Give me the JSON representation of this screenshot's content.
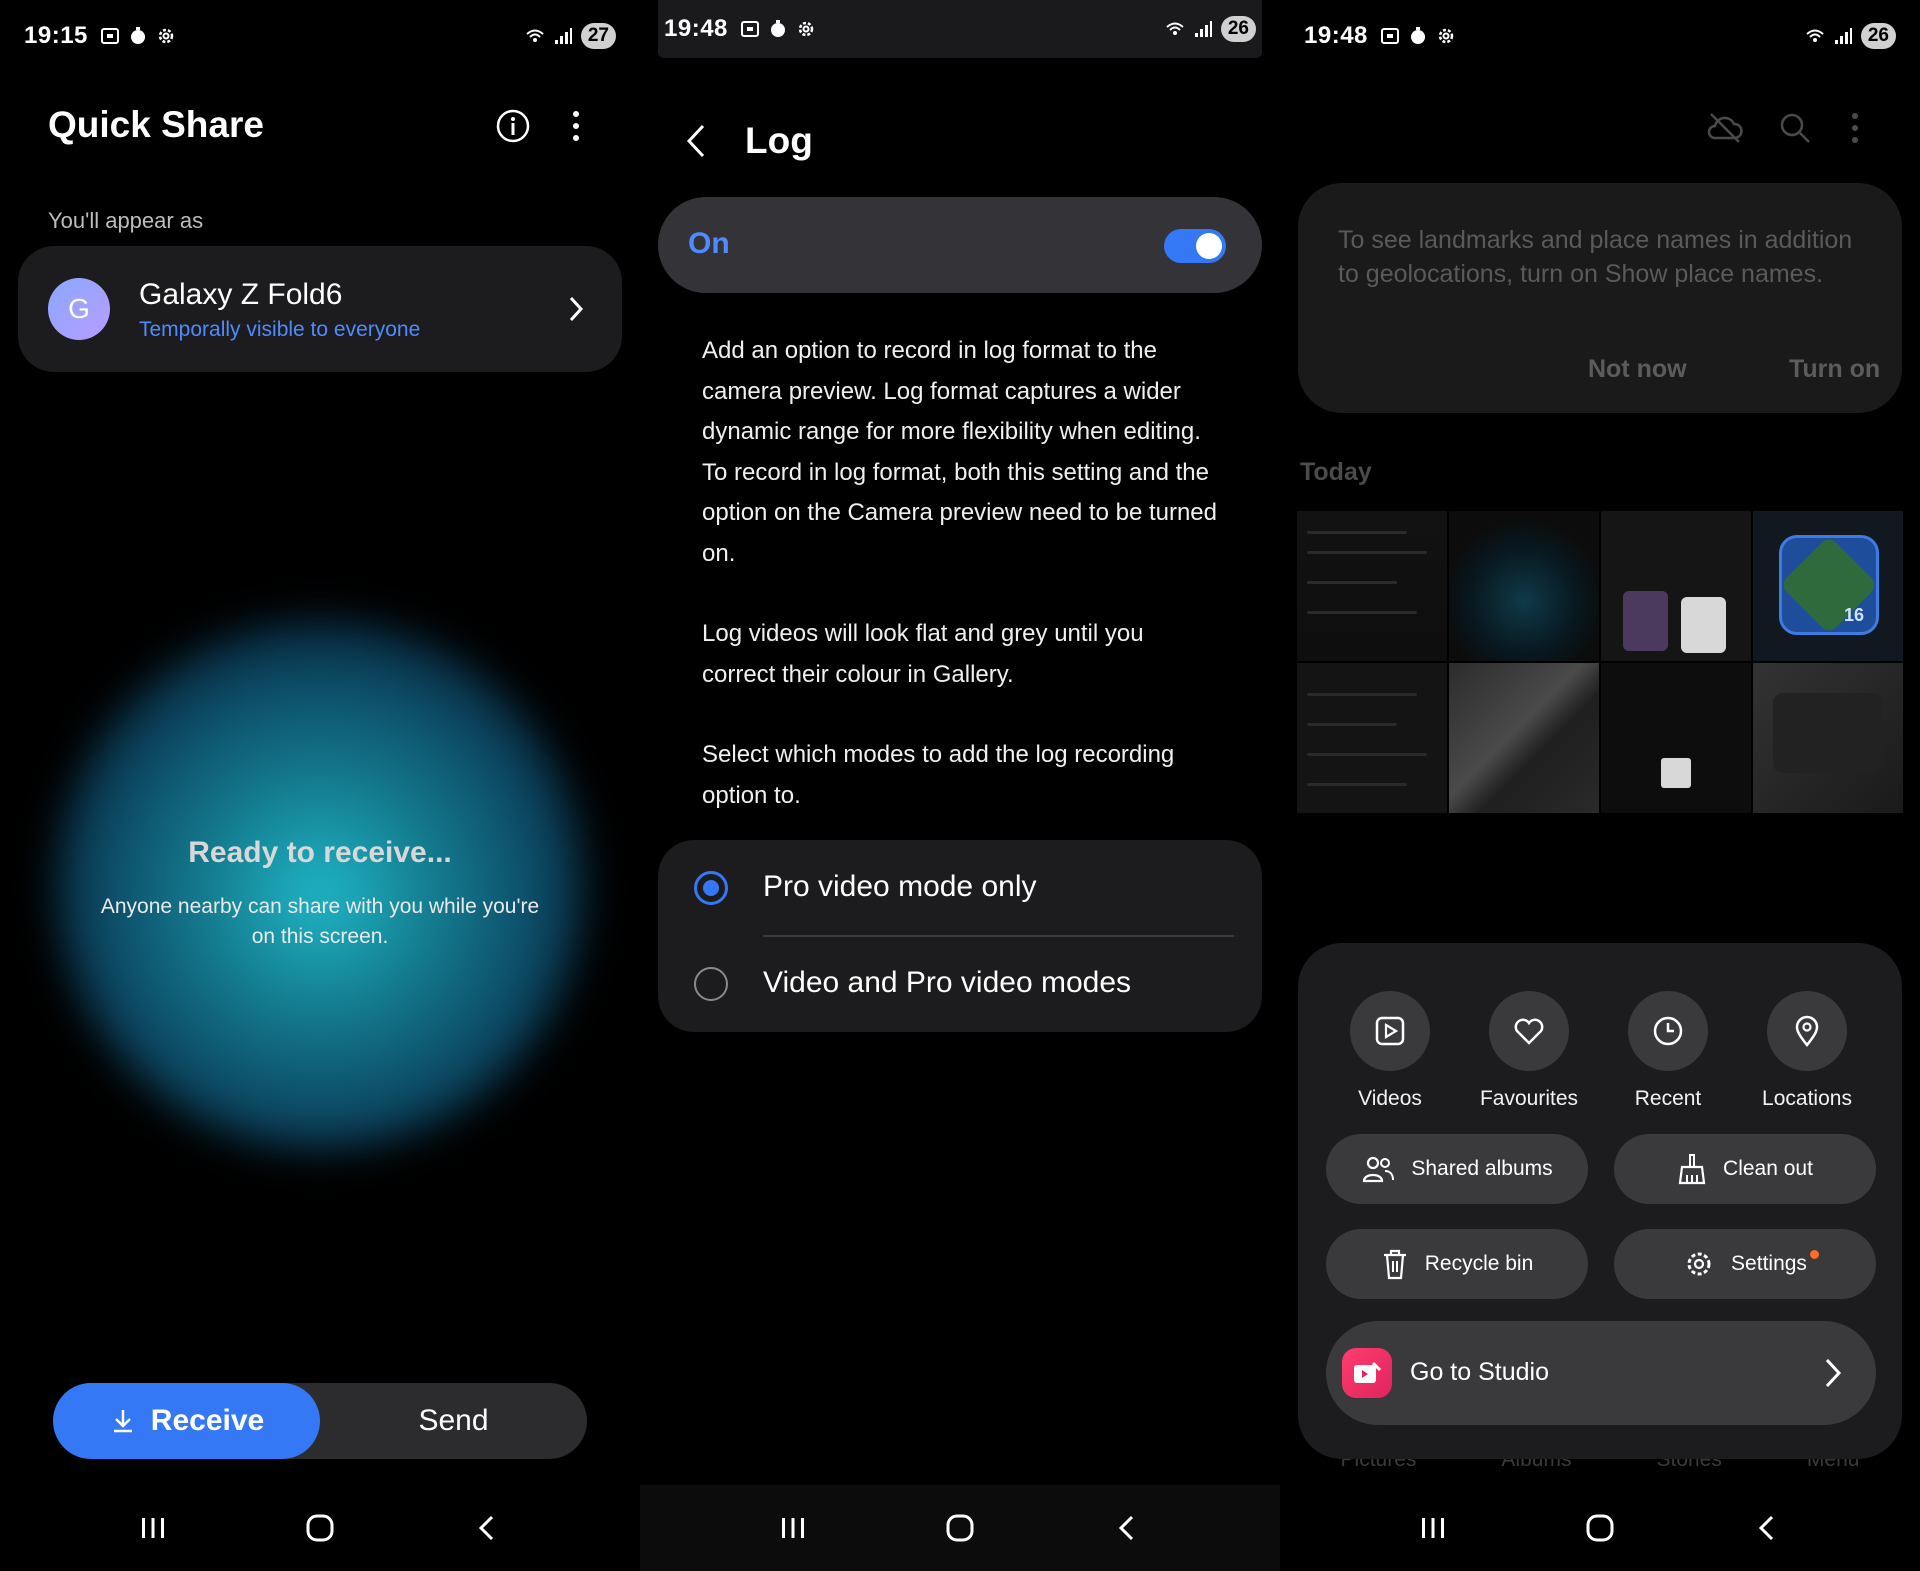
{
  "panel1": {
    "status": {
      "time": "19:15",
      "battery": "27"
    },
    "title": "Quick Share",
    "appear_label": "You'll appear as",
    "device": {
      "initial": "G",
      "name": "Galaxy Z Fold6",
      "visibility": "Temporally visible to everyone"
    },
    "ready_title": "Ready to receive...",
    "ready_sub": "Anyone nearby can share with you while you're on this screen.",
    "receive_label": "Receive",
    "send_label": "Send",
    "icons": {
      "info": "info-icon",
      "more": "more-vert-icon",
      "chevron": "chevron-right-icon",
      "download": "download-icon"
    }
  },
  "panel2": {
    "status": {
      "time": "19:48",
      "battery": "26"
    },
    "title": "Log",
    "toggle_label": "On",
    "toggle_on": true,
    "desc1": "Add an option to record in log format to the camera preview. Log format captures a wider dynamic range for more flexibility when editing. To record in log format, both this setting and the option on the Camera preview need to be turned on.",
    "desc2": "Log videos will look flat and grey until you correct their colour in Gallery.",
    "desc3": "Select which modes to add the log recording option to.",
    "options": [
      {
        "label": "Pro video mode only",
        "checked": true
      },
      {
        "label": "Video and Pro video modes",
        "checked": false
      }
    ]
  },
  "panel3": {
    "status": {
      "time": "19:48",
      "battery": "26"
    },
    "tip": {
      "text": "To see landmarks and place names in addition to geolocations, turn on Show place names.",
      "not_now": "Not now",
      "turn_on": "Turn on"
    },
    "today_label": "Today",
    "thumb_android_num": "16",
    "quick_actions": [
      {
        "label": "Videos",
        "icon": "video-icon"
      },
      {
        "label": "Favourites",
        "icon": "heart-icon"
      },
      {
        "label": "Recent",
        "icon": "clock-icon"
      },
      {
        "label": "Locations",
        "icon": "location-pin-icon"
      }
    ],
    "pills": {
      "shared_albums": "Shared albums",
      "clean_out": "Clean out",
      "recycle_bin": "Recycle bin",
      "settings": "Settings"
    },
    "studio_label": "Go to Studio",
    "behind_tabs": [
      "Pictures",
      "Albums",
      "Stories",
      "Menu"
    ],
    "accent_color": "#3478f6",
    "notification_dot_color": "#ff6a2b"
  }
}
